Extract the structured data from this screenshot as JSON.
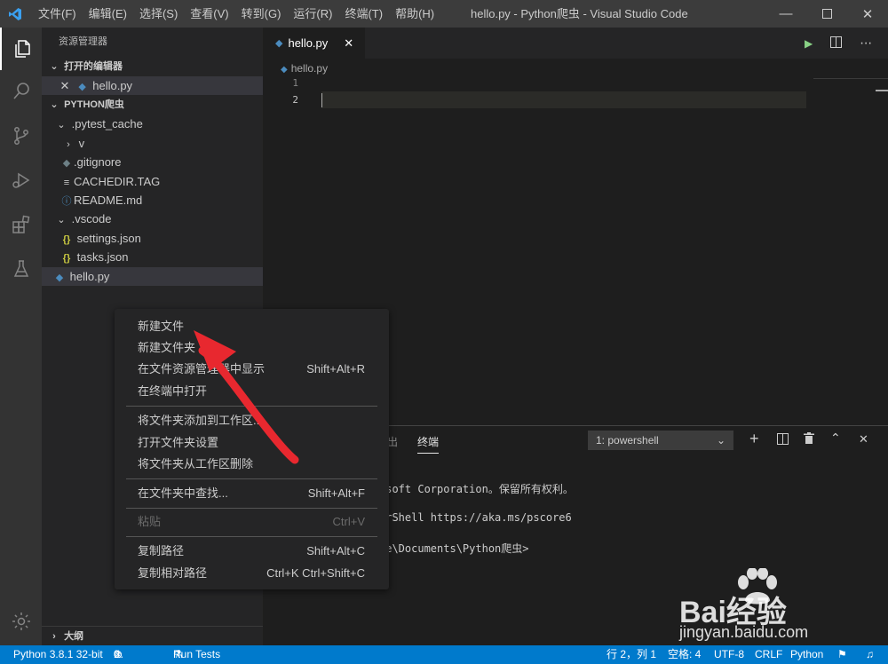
{
  "titlebar": {
    "menu": [
      "文件(F)",
      "编辑(E)",
      "选择(S)",
      "查看(V)",
      "转到(G)",
      "运行(R)",
      "终端(T)",
      "帮助(H)"
    ],
    "title": "hello.py - Python爬虫 - Visual Studio Code"
  },
  "sidebar": {
    "title": "资源管理器",
    "open_editors_label": "打开的编辑器",
    "open_editor_file": "hello.py",
    "folder_label": "PYTHON爬虫",
    "tree": [
      {
        "label": ".pytest_cache",
        "icon": "chevron-down"
      },
      {
        "label": "v",
        "icon": "chevron-right"
      },
      {
        "label": ".gitignore",
        "icon": "git-icon"
      },
      {
        "label": "CACHEDIR.TAG",
        "icon": "file-lines-icon"
      },
      {
        "label": "README.md",
        "icon": "info-icon"
      },
      {
        "label": ".vscode",
        "icon": "chevron-down"
      },
      {
        "label": "settings.json",
        "icon": "json-icon"
      },
      {
        "label": "tasks.json",
        "icon": "json-icon"
      },
      {
        "label": "hello.py",
        "icon": "python-icon"
      }
    ],
    "outline_label": "大纲"
  },
  "editor": {
    "tab_label": "hello.py",
    "breadcrumb": "hello.py",
    "line_numbers": [
      "1",
      "2"
    ]
  },
  "panel": {
    "tab_output": "出",
    "tab_terminal": "终端",
    "terminal_select": "1: powershell",
    "lines": [
      "osoft Corporation。保留所有权利。",
      "erShell https://aka.ms/pscore6",
      "te\\Documents\\Python爬虫>"
    ]
  },
  "context_menu": {
    "items": [
      {
        "label": "新建文件",
        "shortcut": ""
      },
      {
        "label": "新建文件夹",
        "shortcut": ""
      },
      {
        "label": "在文件资源管理器中显示",
        "shortcut": "Shift+Alt+R"
      },
      {
        "label": "在终端中打开",
        "shortcut": ""
      },
      {
        "label": "将文件夹添加到工作区...",
        "shortcut": ""
      },
      {
        "label": "打开文件夹设置",
        "shortcut": ""
      },
      {
        "label": "将文件夹从工作区删除",
        "shortcut": ""
      },
      {
        "label": "在文件夹中查找...",
        "shortcut": "Shift+Alt+F"
      },
      {
        "label": "粘贴",
        "shortcut": "Ctrl+V"
      },
      {
        "label": "复制路径",
        "shortcut": "Shift+Alt+C"
      },
      {
        "label": "复制相对路径",
        "shortcut": "Ctrl+K Ctrl+Shift+C"
      }
    ]
  },
  "statusbar": {
    "python": "Python 3.8.1 32-bit",
    "errors": "0",
    "warnings": "0",
    "run_tests": "Run Tests",
    "position": "行 2，列 1",
    "spaces": "空格: 4",
    "encoding": "UTF-8",
    "eol": "CRLF",
    "language": "Python"
  },
  "watermark": {
    "brand": "Bai经验",
    "url": "jingyan.baidu.com"
  },
  "colors": {
    "accent": "#007acc",
    "arrow": "#e8282f",
    "python": "#4b8bbe",
    "json": "#cbcb41"
  }
}
